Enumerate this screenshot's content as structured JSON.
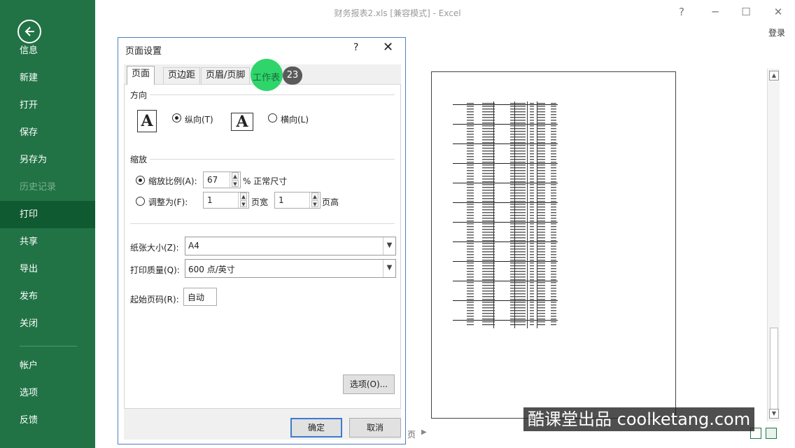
{
  "sidebar": {
    "back_icon": "back-arrow-icon",
    "items": [
      {
        "label": "信息",
        "state": "normal"
      },
      {
        "label": "新建",
        "state": "normal"
      },
      {
        "label": "打开",
        "state": "normal"
      },
      {
        "label": "保存",
        "state": "normal"
      },
      {
        "label": "另存为",
        "state": "normal"
      },
      {
        "label": "历史记录",
        "state": "disabled"
      },
      {
        "label": "打印",
        "state": "active"
      },
      {
        "label": "共享",
        "state": "normal"
      },
      {
        "label": "导出",
        "state": "normal"
      },
      {
        "label": "发布",
        "state": "normal"
      },
      {
        "label": "关闭",
        "state": "normal"
      },
      {
        "label": "帐户",
        "state": "normal"
      },
      {
        "label": "选项",
        "state": "normal"
      },
      {
        "label": "反馈",
        "state": "normal"
      }
    ]
  },
  "window": {
    "title": "财务报表2.xls  [兼容模式] - Excel",
    "help": "?",
    "minimize": "─",
    "maximize": "☐",
    "close": "✕",
    "login": "登录"
  },
  "dialog": {
    "title": "页面设置",
    "help": "?",
    "close": "✕",
    "tabs": [
      "页面",
      "页边距",
      "页眉/页脚",
      "工作表"
    ],
    "active_tab": "页面",
    "step_badge": "23",
    "orientation": {
      "section": "方向",
      "portrait_label": "纵向(T)",
      "landscape_label": "横向(L)",
      "selected": "portrait",
      "glyph": "A"
    },
    "scaling": {
      "section": "缩放",
      "adjust_label": "缩放比例(A):",
      "adjust_value": "67",
      "adjust_suffix": "% 正常尺寸",
      "fit_label": "调整为(F):",
      "fit_wide_value": "1",
      "fit_wide_suffix": "页宽",
      "fit_tall_value": "1",
      "fit_tall_suffix": "页高",
      "selected": "adjust"
    },
    "paper_size_label": "纸张大小(Z):",
    "paper_size_value": "A4",
    "print_quality_label": "打印质量(Q):",
    "print_quality_value": "600 点/英寸",
    "first_page_label": "起始页码(R):",
    "first_page_value": "自动",
    "options_button": "选项(O)...",
    "ok_button": "确定",
    "cancel_button": "取消"
  },
  "preview": {
    "page_label": "页"
  },
  "watermark": "酷课堂出品 coolketang.com",
  "colors": {
    "sidebar": "#217346",
    "sidebar_active": "#0f5a30",
    "highlight": "#2fd56b",
    "dialog_border": "#4d7fc2"
  }
}
